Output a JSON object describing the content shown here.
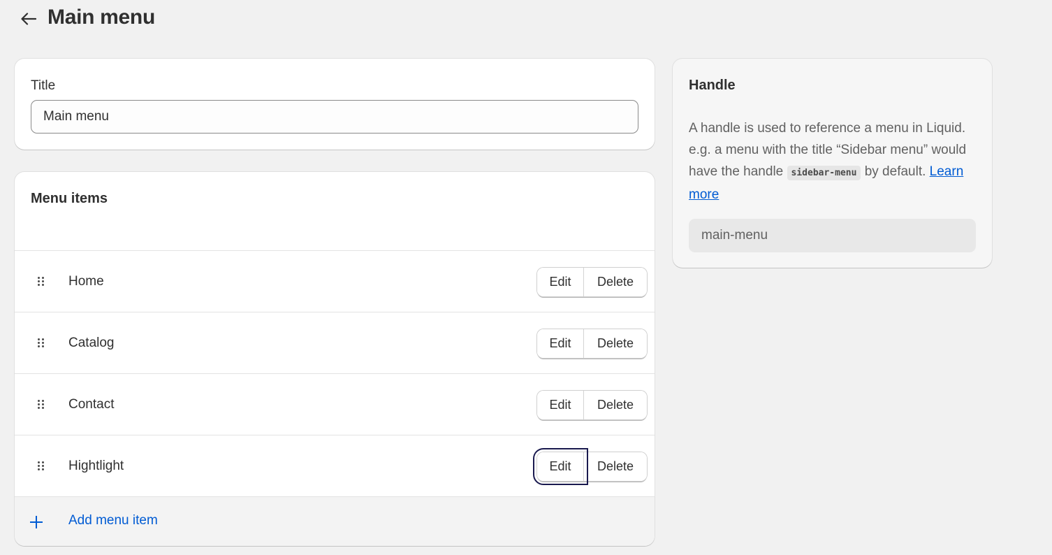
{
  "header": {
    "back_icon": "arrow-left-icon",
    "title": "Main menu"
  },
  "title_card": {
    "label": "Title",
    "value": "Main menu"
  },
  "menu_card": {
    "title": "Menu items",
    "items": [
      {
        "label": "Home",
        "edit": "Edit",
        "delete": "Delete"
      },
      {
        "label": "Catalog",
        "edit": "Edit",
        "delete": "Delete"
      },
      {
        "label": "Contact",
        "edit": "Edit",
        "delete": "Delete"
      },
      {
        "label": "Hightlight",
        "edit": "Edit",
        "delete": "Delete"
      }
    ],
    "add_label": "Add menu item"
  },
  "handle_card": {
    "title": "Handle",
    "desc_before": "A handle is used to reference a menu in Liquid. e.g. a menu with the title “Sidebar menu” would have the handle ",
    "code": "sidebar-menu",
    "desc_after": " by default. ",
    "link": "Learn more",
    "value": "main-menu"
  },
  "colors": {
    "background": "#f1f1f1",
    "card": "#ffffff",
    "link": "#005bd3",
    "focus_ring": "#1a1a4f"
  }
}
